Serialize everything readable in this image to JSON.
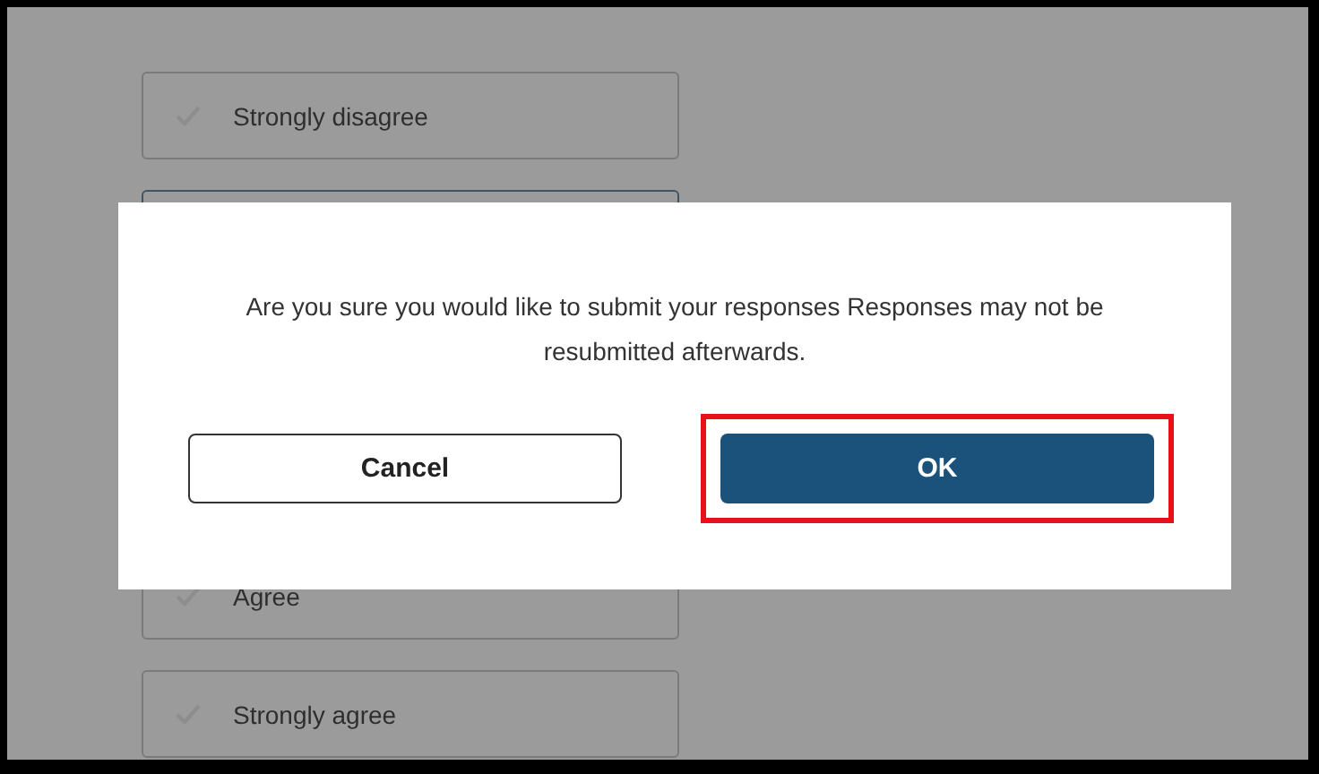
{
  "options": [
    {
      "kind": "visible",
      "label": "Strongly disagree",
      "selected": false
    },
    {
      "kind": "covered",
      "selected": true
    },
    {
      "kind": "visible",
      "label": "Agree",
      "selected": false
    },
    {
      "kind": "visible",
      "label": "Strongly agree",
      "selected": false
    }
  ],
  "dialog": {
    "message": "Are you sure you would like to submit your responses Responses may not be resubmitted afterwards.",
    "buttons": [
      {
        "label": "Cancel",
        "kind": "secondary",
        "highlighted": false
      },
      {
        "label": "OK",
        "kind": "primary",
        "highlighted": true
      }
    ]
  }
}
